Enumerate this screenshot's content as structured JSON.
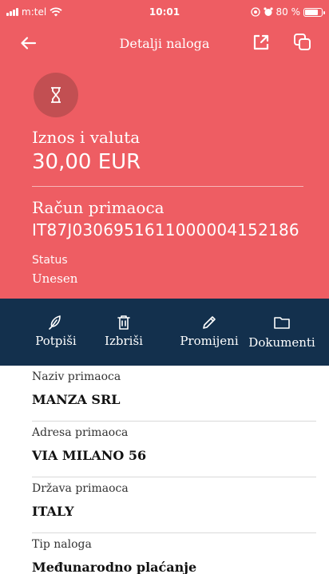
{
  "status_bar": {
    "carrier": "m:tel",
    "time": "10:01",
    "battery_percent": "80 %",
    "battery_level": 0.8
  },
  "header": {
    "title": "Detalji naloga",
    "icons": [
      "back-arrow-icon",
      "open-external-icon",
      "copy-icon"
    ]
  },
  "summary": {
    "status_icon": "hourglass-icon",
    "amount_label": "Iznos i valuta",
    "amount_value": "30,00 EUR",
    "account_label": "Račun primaoca",
    "account_value": "IT87J0306951611000004152186",
    "status_label": "Status",
    "status_value": "Unesen"
  },
  "actions": [
    {
      "label": "Potpiši",
      "icon": "sign-icon"
    },
    {
      "label": "Izbriši",
      "icon": "trash-icon"
    },
    {
      "label": "Promijeni",
      "icon": "edit-icon"
    },
    {
      "label": "Dokumenti",
      "icon": "folder-icon"
    }
  ],
  "details": [
    {
      "label": "Naziv primaoca",
      "value": "MANZA SRL"
    },
    {
      "label": "Adresa primaoca",
      "value": "VIA MILANO 56"
    },
    {
      "label": "Država primaoca",
      "value": "ITALY"
    },
    {
      "label": "Tip naloga",
      "value": "Međunarodno plaćanje"
    }
  ],
  "colors": {
    "header_red": "#ee5d63",
    "status_circle": "#c24f52",
    "action_bar_navy": "#13304d"
  }
}
